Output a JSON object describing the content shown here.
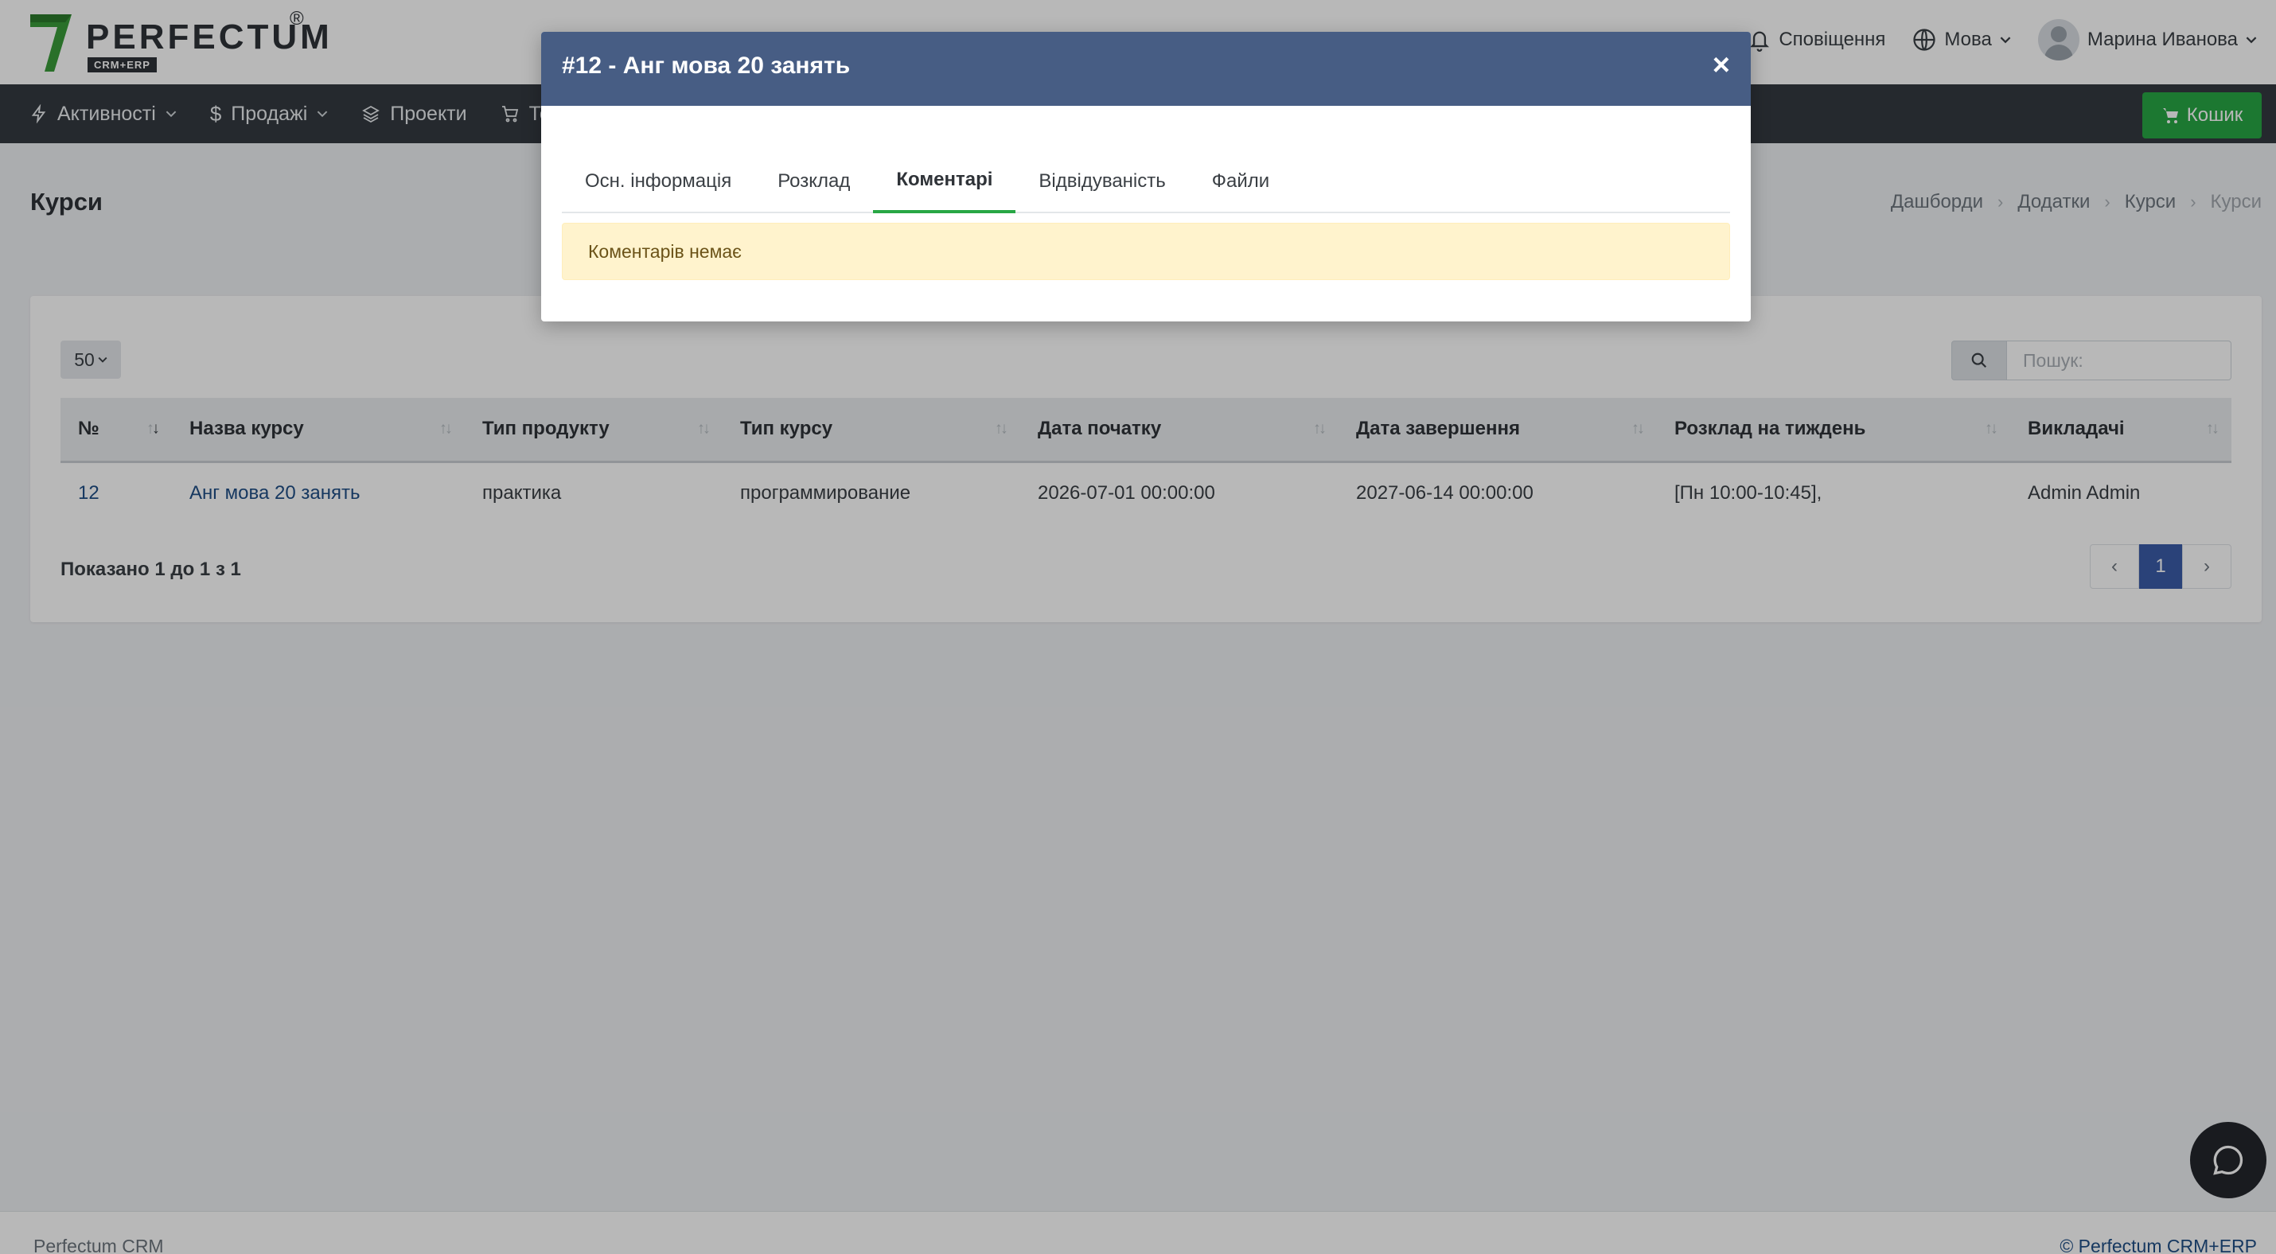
{
  "brand": {
    "name": "PERFECTUM",
    "registered": "®",
    "tagline": "CRM+ERP"
  },
  "header": {
    "notifications_label": "Сповіщення",
    "language_label": "Мова",
    "user_name": "Марина Иванова"
  },
  "nav": {
    "items": [
      {
        "label": "Активності",
        "icon": "bolt-icon",
        "has_dropdown": true
      },
      {
        "label": "Продажі",
        "icon": "dollar-icon",
        "has_dropdown": true
      },
      {
        "label": "Проекти",
        "icon": "layers-icon",
        "has_dropdown": false
      },
      {
        "label": "То",
        "icon": "cart-icon",
        "has_dropdown": false
      }
    ],
    "cart_label": "Кошик"
  },
  "page": {
    "title": "Курси",
    "breadcrumb": [
      "Дашборди",
      "Додатки",
      "Курси",
      "Курси"
    ]
  },
  "table": {
    "page_length": "50",
    "search_placeholder": "Пошук:",
    "columns": [
      "№",
      "Назва курсу",
      "Тип продукту",
      "Тип курсу",
      "Дата початку",
      "Дата завершення",
      "Розклад на тиждень",
      "Викладачі"
    ],
    "rows": [
      {
        "id": "12",
        "name": "Анг мова 20 занять",
        "product_type": "практика",
        "course_type": "программирование",
        "start": "2026-07-01 00:00:00",
        "end": "2027-06-14 00:00:00",
        "schedule": "[Пн 10:00-10:45],",
        "teachers": "Admin Admin"
      }
    ],
    "info": "Показано 1 до 1 з 1",
    "pagination": {
      "prev": "‹",
      "current": "1",
      "next": "›"
    }
  },
  "footer": {
    "left": "Perfectum CRM",
    "right": "© Perfectum CRM+ERP"
  },
  "modal": {
    "title": "#12 - Анг мова 20 занять",
    "close": "×",
    "tabs": [
      "Осн. інформація",
      "Розклад",
      "Коментарі",
      "Відвідуваність",
      "Файли"
    ],
    "active_tab": "Коментарі",
    "empty_message": "Коментарів немає"
  },
  "colors": {
    "accent_green": "#28a745",
    "modal_header": "#475d84",
    "nav_bg": "#343a40",
    "link": "#1f4e86",
    "pager_active": "#3b5ca8",
    "alert_bg": "#fff3cd"
  }
}
